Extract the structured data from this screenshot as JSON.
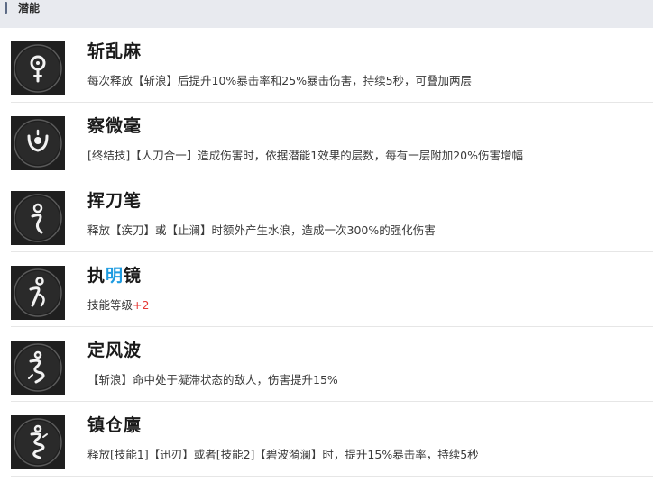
{
  "header": {
    "title": "潜能"
  },
  "potentials": [
    {
      "name": "斩乱麻",
      "icon": "potential-glyph-1-icon",
      "desc": "每次释放【斩浪】后提升10%暴击率和25%暴击伤害，持续5秒，可叠加两层"
    },
    {
      "name": "察微毫",
      "icon": "potential-glyph-2-icon",
      "desc": "[终结技]【人刀合一】造成伤害时，依据潜能1效果的层数，每有一层附加20%伤害增幅"
    },
    {
      "name": "挥刀笔",
      "icon": "potential-glyph-3-icon",
      "desc": "释放【疾刀】或【止澜】时额外产生水浪，造成一次300%的强化伤害"
    },
    {
      "name_parts": [
        "执",
        "明",
        "镜"
      ],
      "icon": "potential-glyph-4-icon",
      "desc_prefix": "技能等级",
      "desc_value": "+2"
    },
    {
      "name": "定风波",
      "icon": "potential-glyph-5-icon",
      "desc": "【斩浪】命中处于凝滞状态的敌人，伤害提升15%"
    },
    {
      "name": "镇仓廪",
      "icon": "potential-glyph-6-icon",
      "desc": "释放[技能1]【迅刃】或者[技能2]【碧波漪澜】时，提升15%暴击率，持续5秒"
    }
  ],
  "colors": {
    "header_bg": "#e8eaef",
    "header_accent": "#5d6b86",
    "highlight_blue": "#1e9be0",
    "plus_red": "#e53935",
    "icon_bg": "#1f1f1f"
  }
}
